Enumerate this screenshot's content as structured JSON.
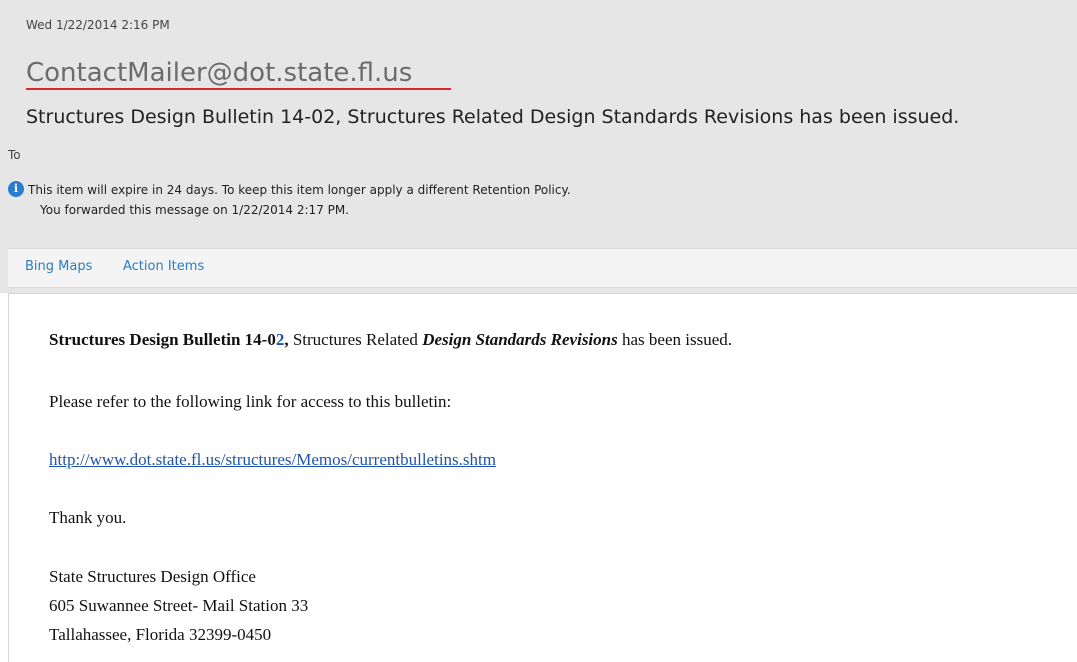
{
  "header": {
    "date": "Wed 1/22/2014 2:16 PM",
    "sender": "ContactMailer@dot.state.fl.us",
    "subject": "Structures Design Bulletin 14-02, Structures Related Design Standards Revisions has been issued.",
    "to_label": "To",
    "info_icon": "info-icon",
    "info_line1": "This item will expire in 24 days. To keep this item longer apply a different Retention Policy.",
    "info_line2": "You forwarded this message on 1/22/2014 2:17 PM."
  },
  "tabs": [
    {
      "label": "Bing Maps"
    },
    {
      "label": "Action Items"
    }
  ],
  "body": {
    "p1": {
      "bold_prefix": "Structures Design Bulletin 14-0",
      "bold_digit": "2",
      "comma": ",",
      "middle": " Structures Related ",
      "italic_bold": "Design Standards Revisions",
      "suffix": " has been issued."
    },
    "p2": "Please refer to the following link for access to this bulletin:",
    "link": "http://www.dot.state.fl.us/structures/Memos/currentbulletins.shtm",
    "thanks": "Thank you.",
    "signature": [
      "State Structures Design Office",
      "605 Suwannee Street- Mail Station 33",
      "Tallahassee, Florida 32399-0450"
    ]
  },
  "colors": {
    "header_bg": "#e6e6e6",
    "accent_blue": "#2a7cc3",
    "underline_red": "#d42a2a",
    "link_blue": "#1f55a8"
  }
}
